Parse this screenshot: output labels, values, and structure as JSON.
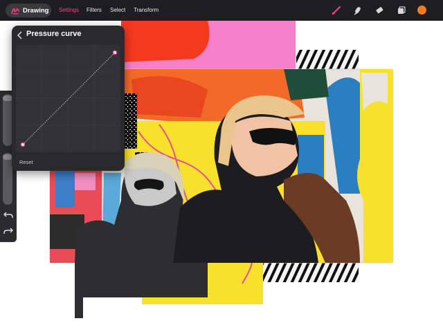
{
  "app": {
    "title": "Drawing",
    "logo_icon": "brush-scribble-icon"
  },
  "menu": {
    "settings": "Settings",
    "filters": "Filters",
    "select": "Select",
    "transform": "Transform",
    "active": "Settings"
  },
  "tools": {
    "brush_icon": "brush-icon",
    "smudge_icon": "smudge-icon",
    "eraser_icon": "eraser-icon",
    "layers_icon": "layers-icon",
    "active_tool": "brush",
    "current_color": "#ff7a1f"
  },
  "sidebar": {
    "brush_size_icon": "slider-icon",
    "opacity_icon": "slider-icon",
    "undo_icon": "undo-icon",
    "redo_icon": "redo-icon"
  },
  "popover": {
    "title": "Pressure curve",
    "back_icon": "chevron-left-icon",
    "reset": "Reset",
    "curve_start": [
      0,
      0
    ],
    "curve_end": [
      1,
      1
    ]
  },
  "colors": {
    "accent": "#ff3e7f",
    "toolbar": "#1e1e20",
    "panel": "#2a2a2c"
  },
  "artwork": {
    "description_icon": "collage-image"
  }
}
